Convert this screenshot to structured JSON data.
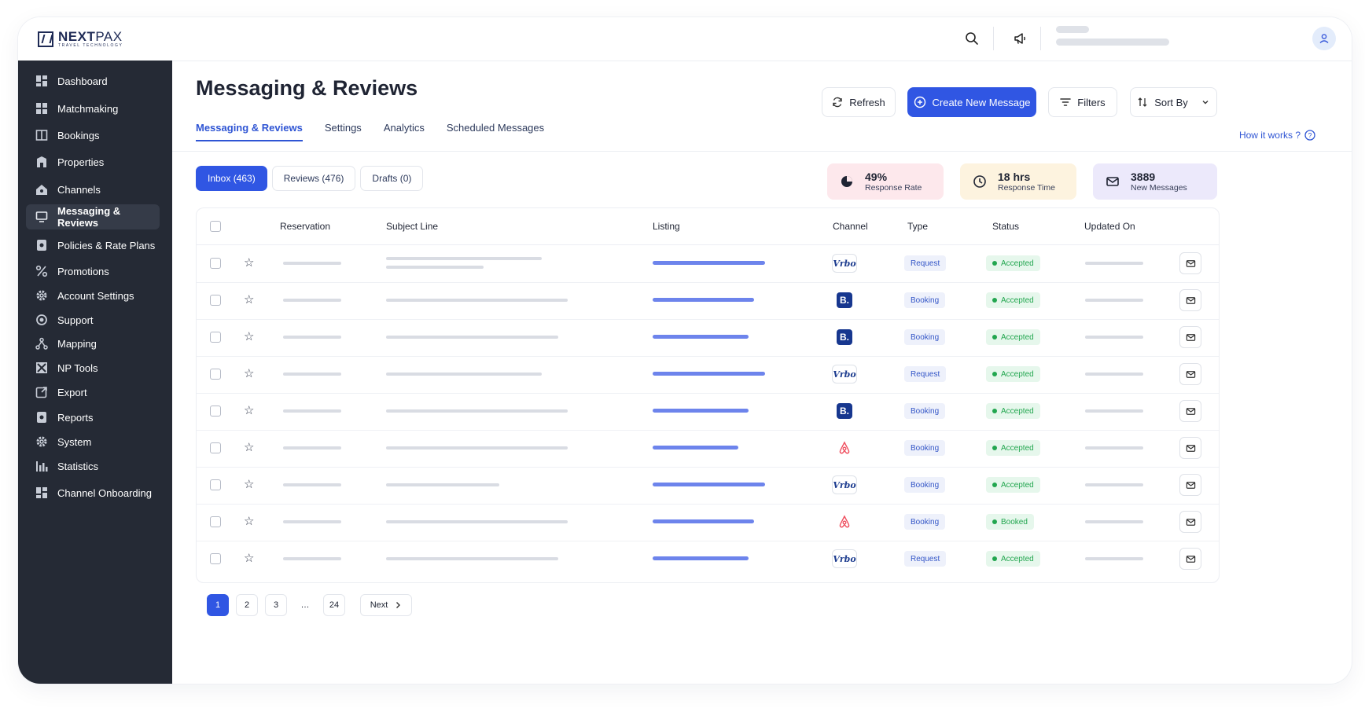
{
  "logo": {
    "main_bold": "NEXT",
    "main_thin": "PAX",
    "tagline": "TRAVEL TECHNOLOGY"
  },
  "sidebar": {
    "items": [
      {
        "label": "Dashboard",
        "icon": "dashboard-icon"
      },
      {
        "label": "Matchmaking",
        "icon": "grid-icon"
      },
      {
        "label": "Bookings",
        "icon": "book-icon"
      },
      {
        "label": "Properties",
        "icon": "building-icon"
      },
      {
        "label": "Channels",
        "icon": "house-icon"
      },
      {
        "label": "Messaging & Reviews",
        "icon": "monitor-icon",
        "active": true
      },
      {
        "label": "Policies & Rate Plans",
        "icon": "policy-icon"
      },
      {
        "label": "Promotions",
        "icon": "percent-icon"
      },
      {
        "label": "Account Settings",
        "icon": "gear-icon"
      },
      {
        "label": "Support",
        "icon": "support-icon"
      },
      {
        "label": "Mapping",
        "icon": "mapping-icon"
      },
      {
        "label": "NP Tools",
        "icon": "tools-icon"
      },
      {
        "label": "Export",
        "icon": "export-icon"
      },
      {
        "label": "Reports",
        "icon": "reports-icon"
      },
      {
        "label": "System",
        "icon": "gear-icon"
      },
      {
        "label": "Statistics",
        "icon": "bar-chart-icon"
      },
      {
        "label": "Channel Onboarding",
        "icon": "grid-icon"
      }
    ]
  },
  "main": {
    "title": "Messaging & Reviews",
    "tabs": [
      "Messaging & Reviews",
      "Settings",
      "Analytics",
      "Scheduled Messages"
    ],
    "buttons": {
      "refresh": "Refresh",
      "create": "Create New Message",
      "filters": "Filters",
      "sort": "Sort By"
    },
    "how_it_works": "How it works ?",
    "subtabs": [
      "Inbox (463)",
      "Reviews (476)",
      "Drafts (0)"
    ],
    "stats": [
      {
        "value": "49%",
        "label": "Response Rate",
        "color": "#fde8ec",
        "icon": "pie-chart-icon"
      },
      {
        "value": "18 hrs",
        "label": "Response Time",
        "color": "#fdf3df",
        "icon": "clock-icon"
      },
      {
        "value": "3889",
        "label": "New Messages",
        "color": "#ece9fb",
        "icon": "envelope-icon"
      }
    ],
    "table": {
      "columns": [
        "Reservation",
        "Subject Line",
        "Listing",
        "Channel",
        "Type",
        "Status",
        "Updated On"
      ],
      "rows": [
        {
          "channel": "Vrbo",
          "type": "Request",
          "status": "Accepted"
        },
        {
          "channel": "B.",
          "type": "Booking",
          "status": "Accepted"
        },
        {
          "channel": "B.",
          "type": "Booking",
          "status": "Accepted"
        },
        {
          "channel": "Vrbo",
          "type": "Request",
          "status": "Accepted"
        },
        {
          "channel": "B.",
          "type": "Booking",
          "status": "Accepted"
        },
        {
          "channel": "airbnb",
          "type": "Booking",
          "status": "Accepted"
        },
        {
          "channel": "Vrbo",
          "type": "Booking",
          "status": "Accepted"
        },
        {
          "channel": "airbnb",
          "type": "Booking",
          "status": "Booked"
        },
        {
          "channel": "Vrbo",
          "type": "Request",
          "status": "Accepted"
        }
      ]
    },
    "pagination": {
      "pages": [
        "1",
        "2",
        "3",
        "…",
        "24"
      ],
      "current": "1",
      "next": "Next"
    }
  },
  "colors": {
    "accent": "#3056e3",
    "sidebar": "#252a35",
    "status_green": "#22a64f"
  }
}
